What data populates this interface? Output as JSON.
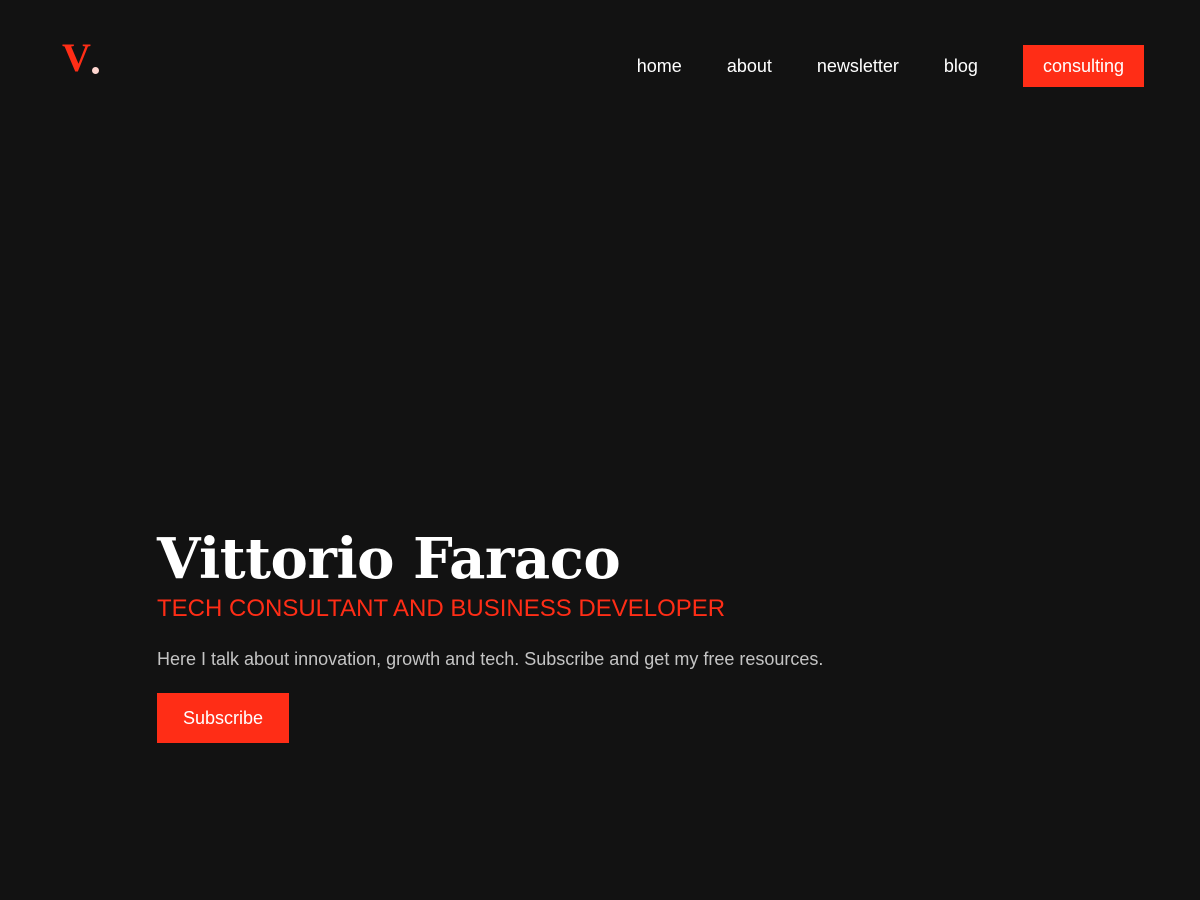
{
  "brand": {
    "logo_letter": "V",
    "accent_color": "#ff2d16",
    "background_color": "#121212"
  },
  "nav": {
    "items": [
      {
        "label": "home"
      },
      {
        "label": "about"
      },
      {
        "label": "newsletter"
      },
      {
        "label": "blog"
      }
    ],
    "cta_label": "consulting"
  },
  "hero": {
    "title": "Vittorio Faraco",
    "subtitle": "TECH CONSULTANT AND BUSINESS DEVELOPER",
    "description": "Here I talk about innovation, growth and tech. Subscribe and get my free resources.",
    "button_label": "Subscribe"
  }
}
